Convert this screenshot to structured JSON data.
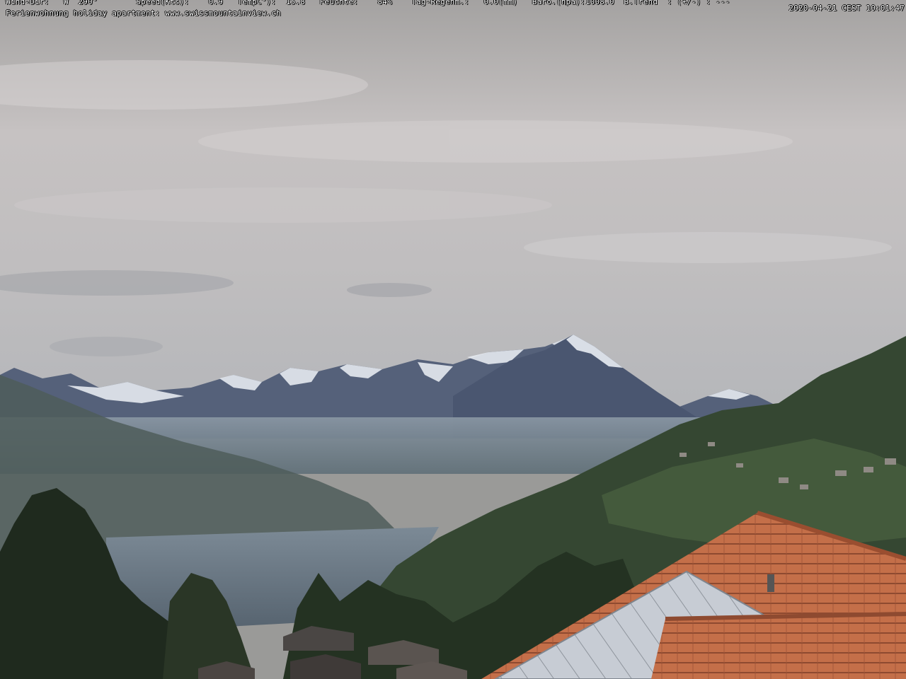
{
  "weather": {
    "wind_dir_label": "Wind-Dir:",
    "wind_dir_value": "W  290°",
    "speed_label": "Speed(Kts):",
    "speed_value": "0.9",
    "temp_label": "TempC°):",
    "temp_value": "15.8",
    "humidity_label": "Feuchte:",
    "humidity_value": "84%",
    "rain_label": "Tag-Regenm.:",
    "rain_value": "0.0(mm)",
    "baro_label": "Baro.(hpa):1008.0",
    "trend_label": "B.Trend  : (+/-) : ---"
  },
  "caption": {
    "site": "Ferienwohnung holiday apartment: www.swissmountainview.ch",
    "timestamp": "2020-04-21 CEST 10:01:47"
  },
  "colors": {
    "sky_top": "#a9a7a6",
    "sky_mid": "#c9c5c5",
    "sky_low": "#b9b9bb",
    "mountain": "#4d5a72",
    "snow": "#e4e8ee",
    "haze": "#6f7f8e",
    "lake": "#5e6d7a",
    "forest": "#2f3f2c",
    "roof_tile": "#c4704a",
    "solar_panel": "#c9ced6"
  }
}
